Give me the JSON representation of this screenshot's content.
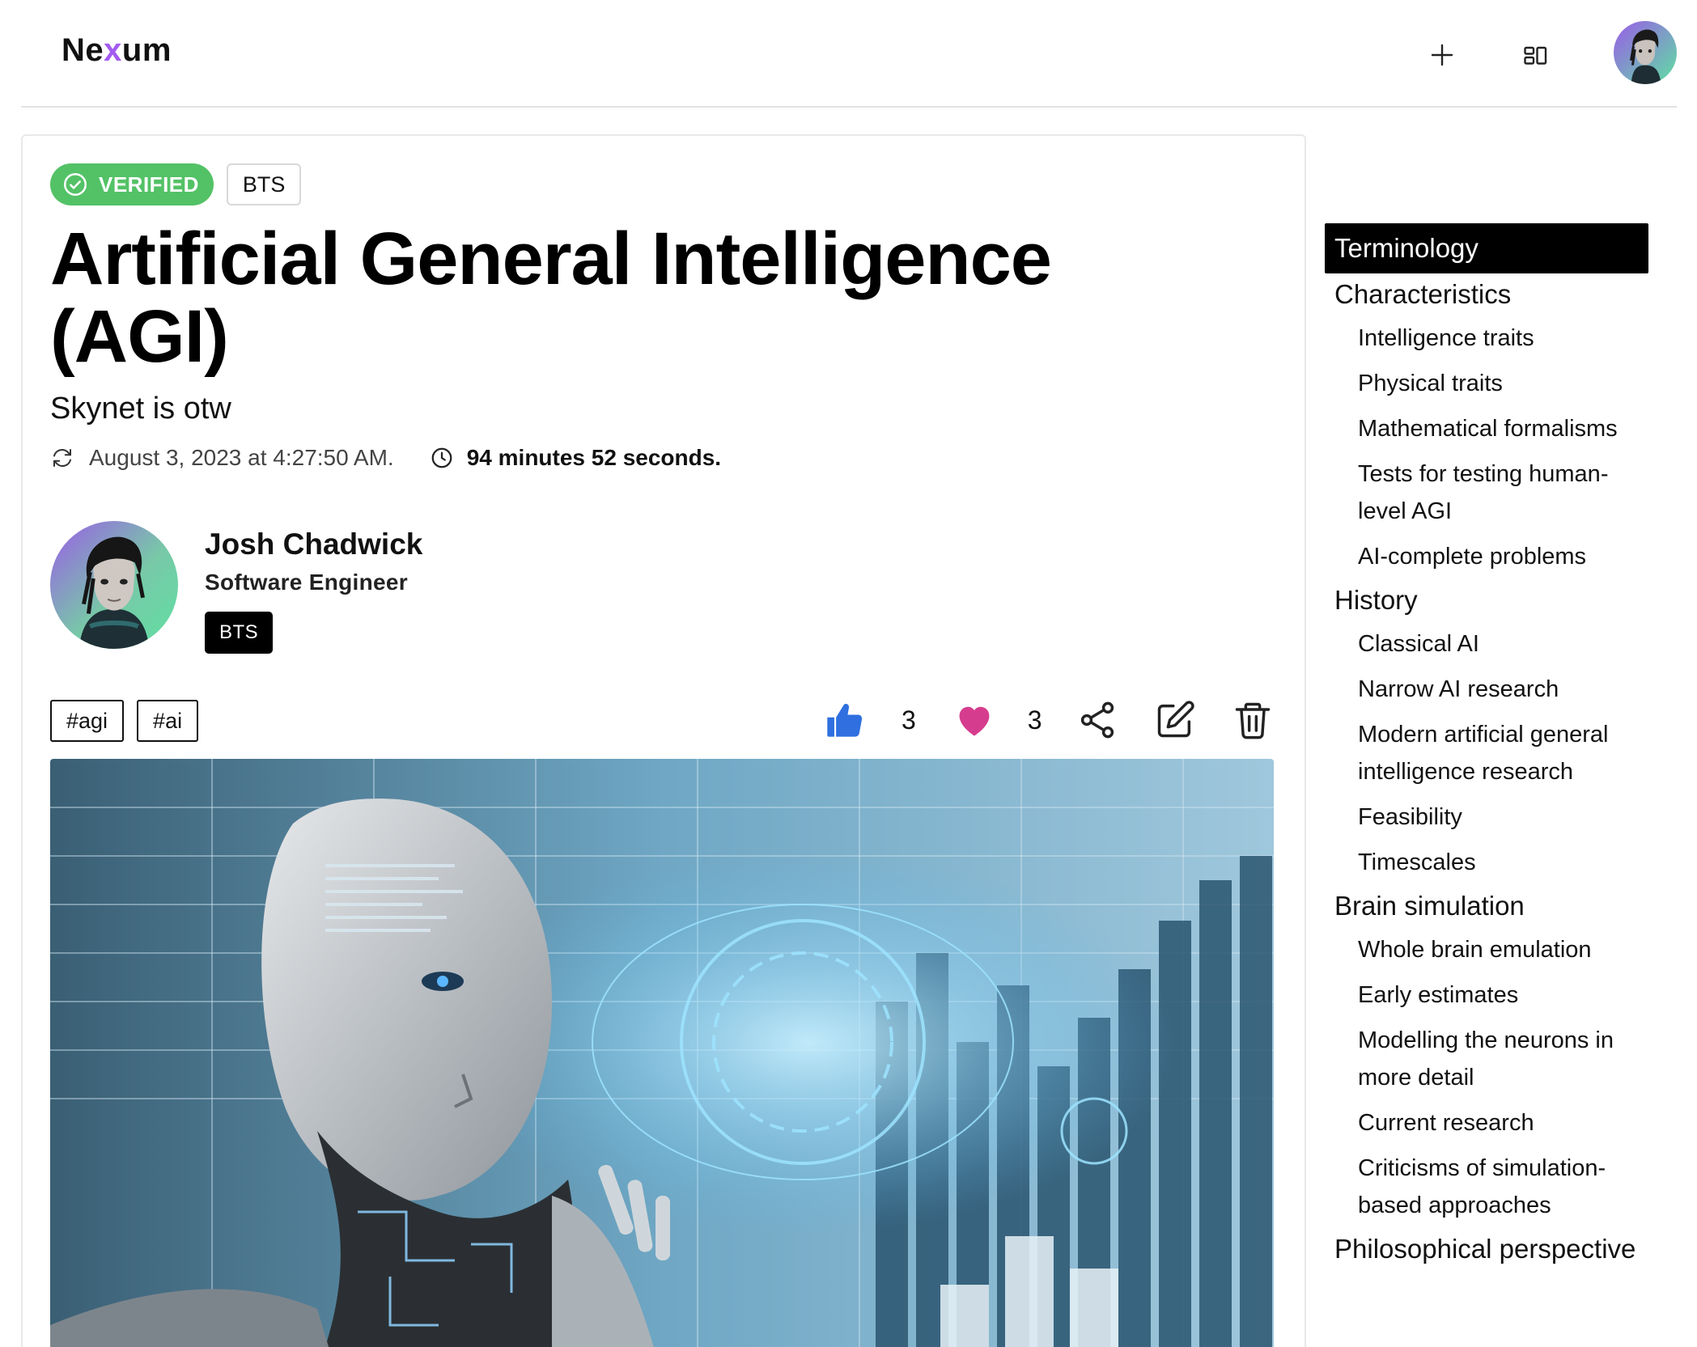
{
  "header": {
    "logo_prefix": "Ne",
    "logo_accent": "x",
    "logo_suffix": "um",
    "icons": {
      "add": "plus-icon",
      "layout": "grid-icon"
    }
  },
  "article": {
    "verified_label": "VERIFIED",
    "category_tag": "BTS",
    "title": "Artificial General Intelligence (AGI)",
    "subtitle": "Skynet is otw",
    "date": "August 3, 2023 at 4:27:50 AM.",
    "duration": "94 minutes 52 seconds.",
    "author": {
      "name": "Josh Chadwick",
      "role": "Software Engineer",
      "badge": "BTS"
    },
    "hashtags": [
      "#agi",
      "#ai"
    ],
    "likes": "3",
    "hearts": "3",
    "colors": {
      "verified": "#53c266",
      "like": "#2f6fe0",
      "heart": "#d63c8e",
      "logo_accent": "#a35bf0"
    }
  },
  "toc": {
    "items": [
      {
        "label": "Terminology",
        "level": 1,
        "active": true
      },
      {
        "label": "Characteristics",
        "level": 1
      },
      {
        "label": "Intelligence traits",
        "level": 2
      },
      {
        "label": "Physical traits",
        "level": 2
      },
      {
        "label": "Mathematical formalisms",
        "level": 2
      },
      {
        "label": "Tests for testing human-level AGI",
        "level": 2
      },
      {
        "label": "AI-complete problems",
        "level": 2
      },
      {
        "label": "History",
        "level": 1
      },
      {
        "label": "Classical AI",
        "level": 2
      },
      {
        "label": "Narrow AI research",
        "level": 2
      },
      {
        "label": "Modern artificial general intelligence research",
        "level": 2
      },
      {
        "label": "Feasibility",
        "level": 2
      },
      {
        "label": "Timescales",
        "level": 2
      },
      {
        "label": "Brain simulation",
        "level": 1
      },
      {
        "label": "Whole brain emulation",
        "level": 2
      },
      {
        "label": "Early estimates",
        "level": 2
      },
      {
        "label": "Modelling the neurons in more detail",
        "level": 2
      },
      {
        "label": "Current research",
        "level": 2
      },
      {
        "label": "Criticisms of simulation-based approaches",
        "level": 2
      },
      {
        "label": "Philosophical perspective",
        "level": 1
      }
    ]
  }
}
